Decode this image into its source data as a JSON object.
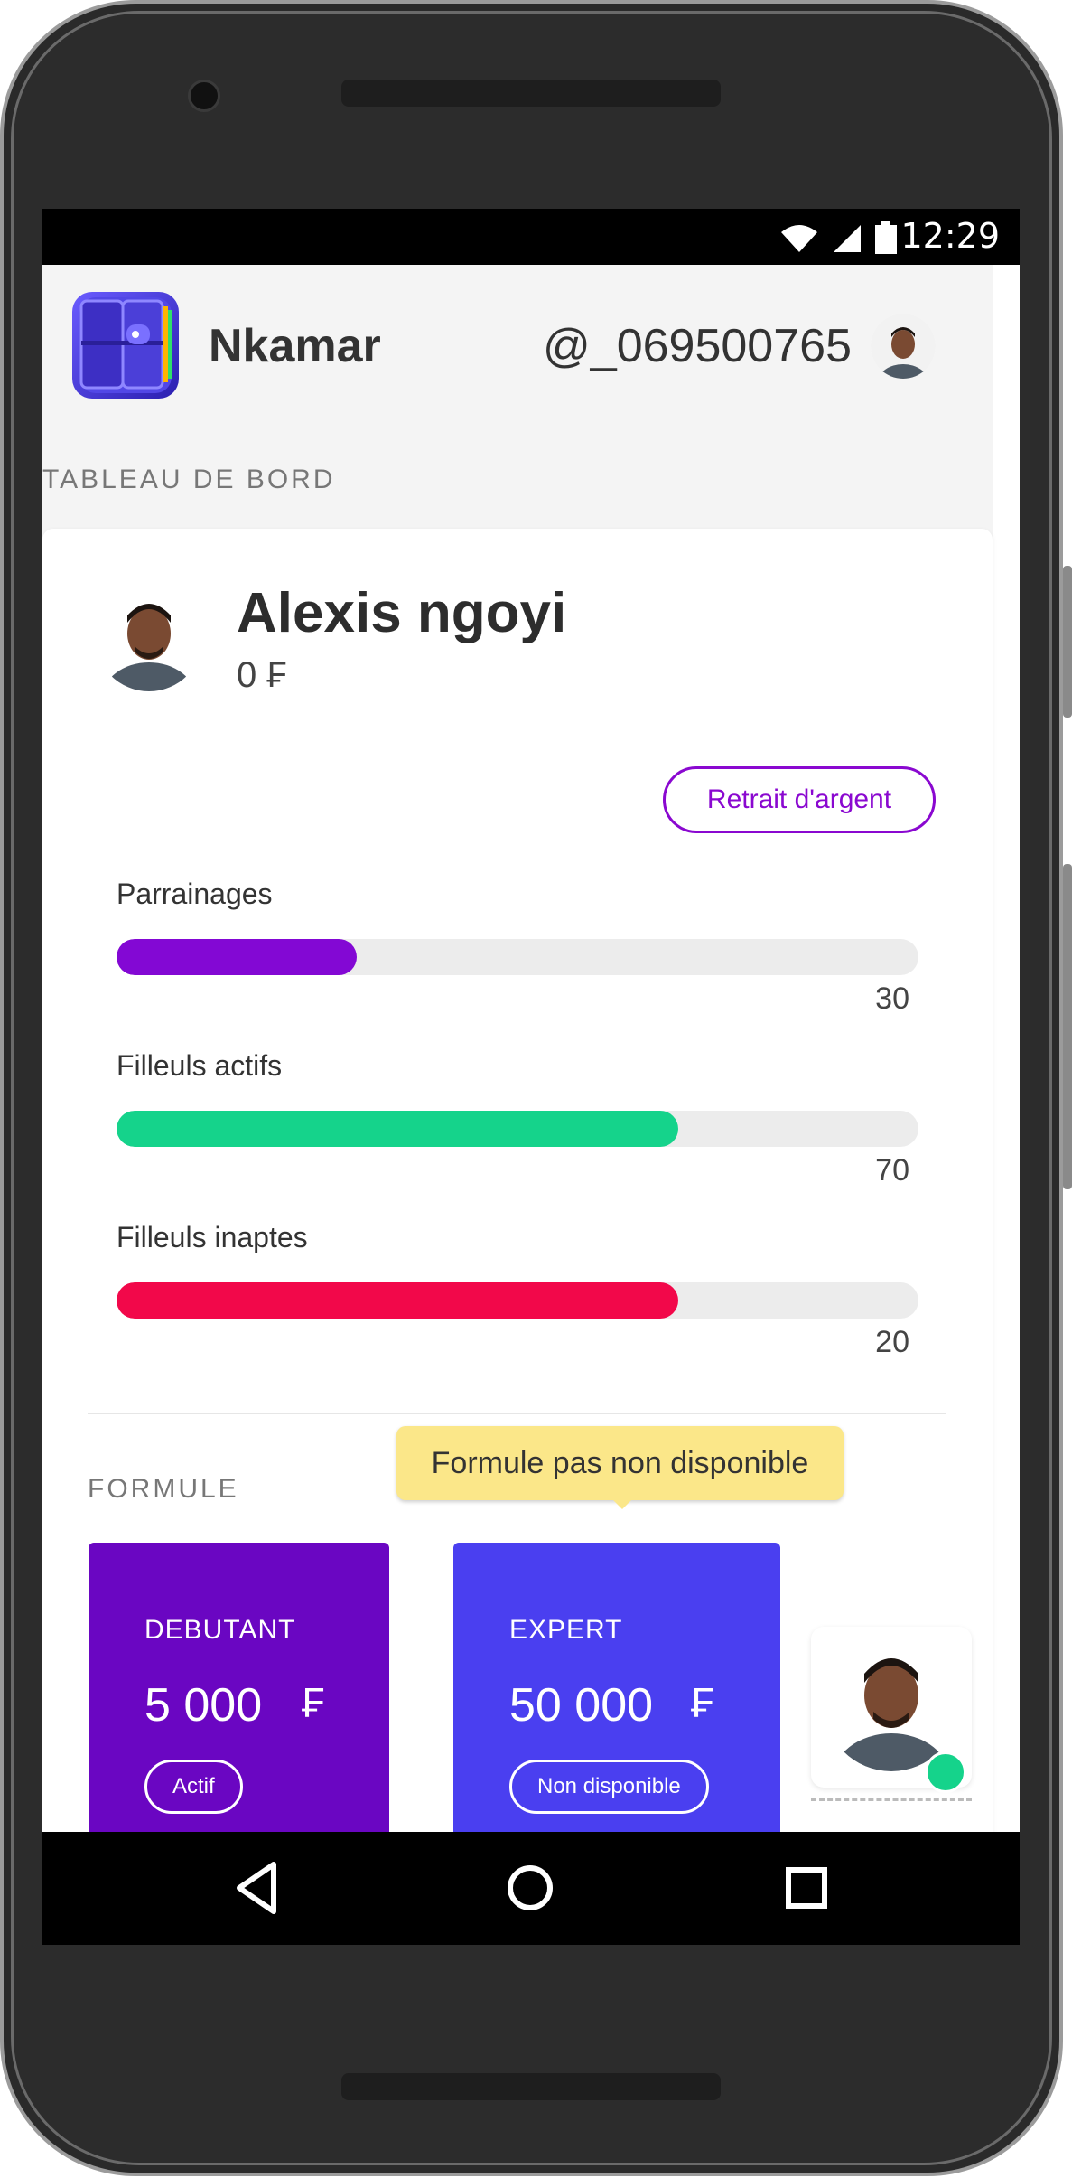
{
  "status_bar": {
    "time": "12:29"
  },
  "header": {
    "app_name": "Nkamar",
    "username": "@_069500765"
  },
  "dashboard": {
    "section_title": "TABLEAU DE BORD"
  },
  "profile": {
    "name": "Alexis ngoyi",
    "balance": "0 ₣",
    "withdraw_label": "Retrait d'argent"
  },
  "stats": [
    {
      "label": "Parrainages",
      "value": "30",
      "color": "#8308d4"
    },
    {
      "label": "Filleuls actifs",
      "value": "70",
      "color": "#15d38b"
    },
    {
      "label": "Filleuls inaptes",
      "value": "20",
      "color": "#f2084a"
    }
  ],
  "formule": {
    "section_title": "FORMULE",
    "tooltip": "Formule pas non disponible",
    "plans": [
      {
        "name": "DEBUTANT",
        "price": "5 000",
        "currency": "₣",
        "button_label": "Actif",
        "color": "#6a06c2"
      },
      {
        "name": "EXPERT",
        "price": "50 000",
        "currency": "₣",
        "button_label": "Non disponible",
        "color": "#4a3ff0"
      }
    ]
  },
  "icons": {
    "status": [
      "wifi-icon",
      "signal-icon",
      "battery-icon"
    ],
    "nav": [
      "back-icon",
      "home-icon",
      "recents-icon"
    ]
  }
}
